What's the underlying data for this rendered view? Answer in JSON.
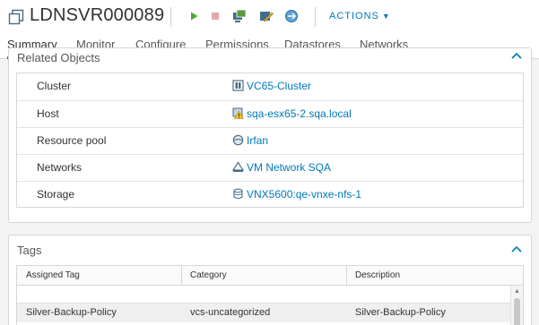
{
  "vm": {
    "name": "LDNSVR000089"
  },
  "toolbar": {
    "actions_label": "ACTIONS"
  },
  "tabs": [
    {
      "label": "Summary",
      "active": true
    },
    {
      "label": "Monitor"
    },
    {
      "label": "Configure"
    },
    {
      "label": "Permissions"
    },
    {
      "label": "Datastores"
    },
    {
      "label": "Networks"
    }
  ],
  "related": {
    "title": "Related Objects",
    "rows": [
      {
        "label": "Cluster",
        "value": "VC65-Cluster",
        "icon": "cluster-icon"
      },
      {
        "label": "Host",
        "value": "sqa-esx65-2.sqa.local",
        "icon": "host-warning-icon"
      },
      {
        "label": "Resource pool",
        "value": "Irfan",
        "icon": "resource-pool-icon"
      },
      {
        "label": "Networks",
        "value": "VM Network SQA",
        "icon": "network-icon"
      },
      {
        "label": "Storage",
        "value": "VNX5600:qe-vnxe-nfs-1",
        "icon": "datastore-icon"
      }
    ]
  },
  "tags": {
    "title": "Tags",
    "columns": [
      "Assigned Tag",
      "Category",
      "Description"
    ],
    "rows": [
      {
        "tag": "Silver-Backup-Policy",
        "category": "vcs-uncategorized",
        "description": "Silver-Backup-Policy"
      }
    ]
  },
  "colors": {
    "accent": "#0079b8",
    "power_on": "#4aa830",
    "power_off": "#e4a8a8"
  }
}
